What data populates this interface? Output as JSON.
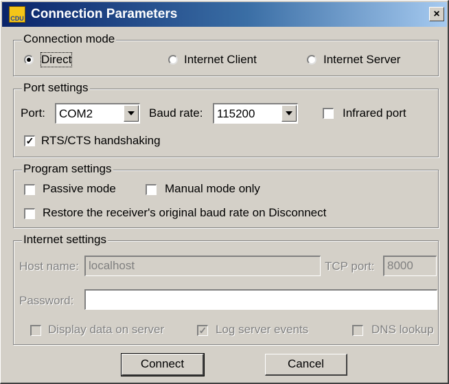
{
  "window": {
    "title": "Connection Parameters",
    "icon": "app-icon",
    "icon_text": "CDU",
    "close_label": "×"
  },
  "connection_mode": {
    "title": "Connection mode",
    "options": [
      "Direct",
      "Internet Client",
      "Internet Server"
    ],
    "selected": "Direct"
  },
  "port_settings": {
    "title": "Port settings",
    "port_label": "Port:",
    "port_value": "COM2",
    "baud_label": "Baud rate:",
    "baud_value": "115200",
    "infrared_label": "Infrared port",
    "infrared_checked": false,
    "rts_label": "RTS/CTS handshaking",
    "rts_checked": true
  },
  "program_settings": {
    "title": "Program settings",
    "passive_label": "Passive mode",
    "passive_checked": false,
    "manual_label": "Manual mode only",
    "manual_checked": false,
    "restore_label": "Restore the receiver's original baud rate on Disconnect",
    "restore_checked": false
  },
  "internet_settings": {
    "title": "Internet settings",
    "host_label": "Host name:",
    "host_value": "localhost",
    "tcp_label": "TCP port:",
    "tcp_value": "8000",
    "password_label": "Password:",
    "password_value": "",
    "display_label": "Display data on server",
    "display_checked": false,
    "log_label": "Log server events",
    "log_checked": true,
    "dns_label": "DNS lookup",
    "dns_checked": false
  },
  "buttons": {
    "connect": "Connect",
    "cancel": "Cancel"
  },
  "colors": {
    "face": "#d4d0c8",
    "title_start": "#0a246a",
    "title_end": "#a6caf0",
    "disabled_text": "#808080"
  }
}
